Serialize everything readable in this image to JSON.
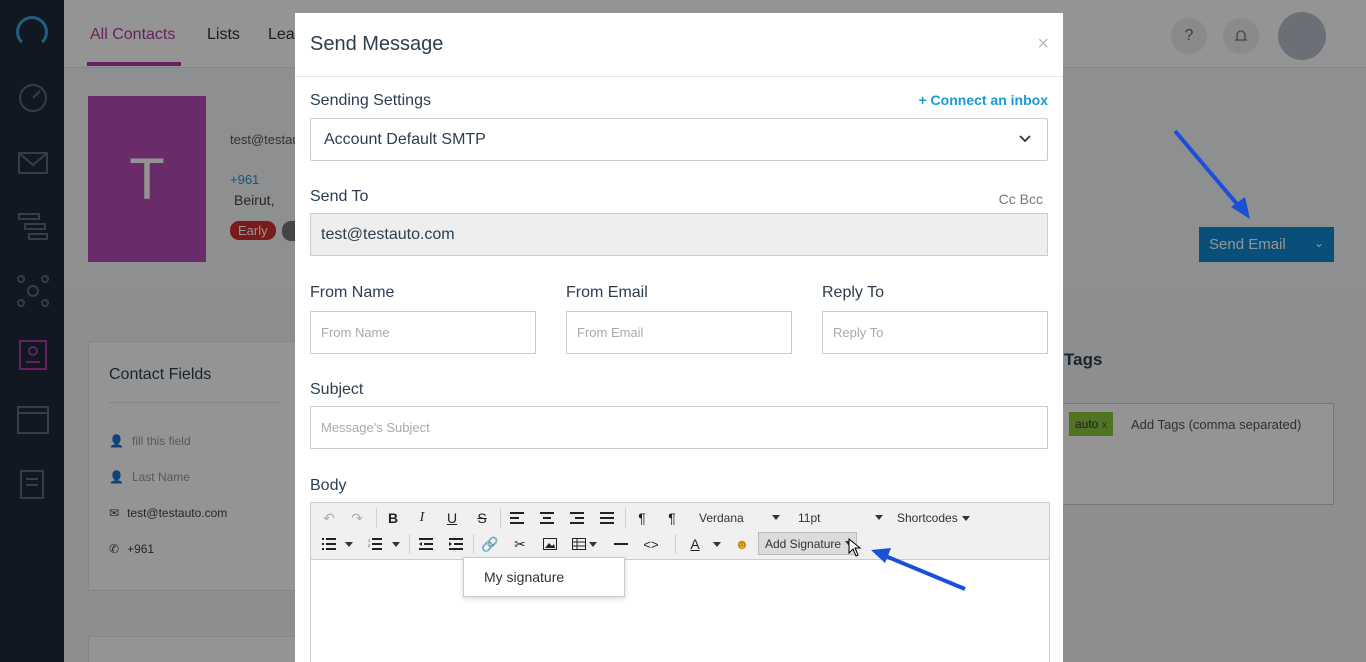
{
  "nav": {
    "icons": [
      "dashboard-icon",
      "mail-icon",
      "pipeline-icon",
      "network-icon",
      "contacts-icon",
      "pages-icon",
      "tasks-icon"
    ]
  },
  "topbar": {
    "tabs": [
      "All Contacts",
      "Lists",
      "Lea"
    ],
    "help_icon": "?",
    "bell_icon": "bell"
  },
  "contact": {
    "initial": "T",
    "email": "test@testau",
    "phone": "+961",
    "location": "Beirut,",
    "badge": "Early",
    "send_email_label": "Send Email"
  },
  "contact_fields": {
    "title": "Contact Fields",
    "rows": [
      {
        "icon": "person-icon",
        "text": "fill this field"
      },
      {
        "icon": "person-icon",
        "text": "Last Name"
      },
      {
        "icon": "mail-icon",
        "text": "test@testauto.com"
      },
      {
        "icon": "phone-icon",
        "text": "+961"
      }
    ]
  },
  "tags": {
    "title": "Tags",
    "tag": "auto",
    "tag_remove": "x",
    "placeholder": "Add Tags (comma separated)"
  },
  "modal": {
    "title": "Send Message",
    "close": "×",
    "sending_settings_label": "Sending Settings",
    "connect_inbox": "Connect an inbox",
    "smtp_value": "Account Default SMTP",
    "send_to_label": "Send To",
    "cc_bcc": "Cc Bcc",
    "send_to_value": "test@testauto.com",
    "from_name_label": "From Name",
    "from_name_placeholder": "From Name",
    "from_email_label": "From Email",
    "from_email_placeholder": "From Email",
    "reply_to_label": "Reply To",
    "reply_to_placeholder": "Reply To",
    "subject_label": "Subject",
    "subject_placeholder": "Message's Subject",
    "body_label": "Body"
  },
  "editor": {
    "font": "Verdana",
    "size": "11pt",
    "shortcodes": "Shortcodes",
    "add_signature": "Add Signature",
    "signature_items": [
      "My signature"
    ]
  }
}
